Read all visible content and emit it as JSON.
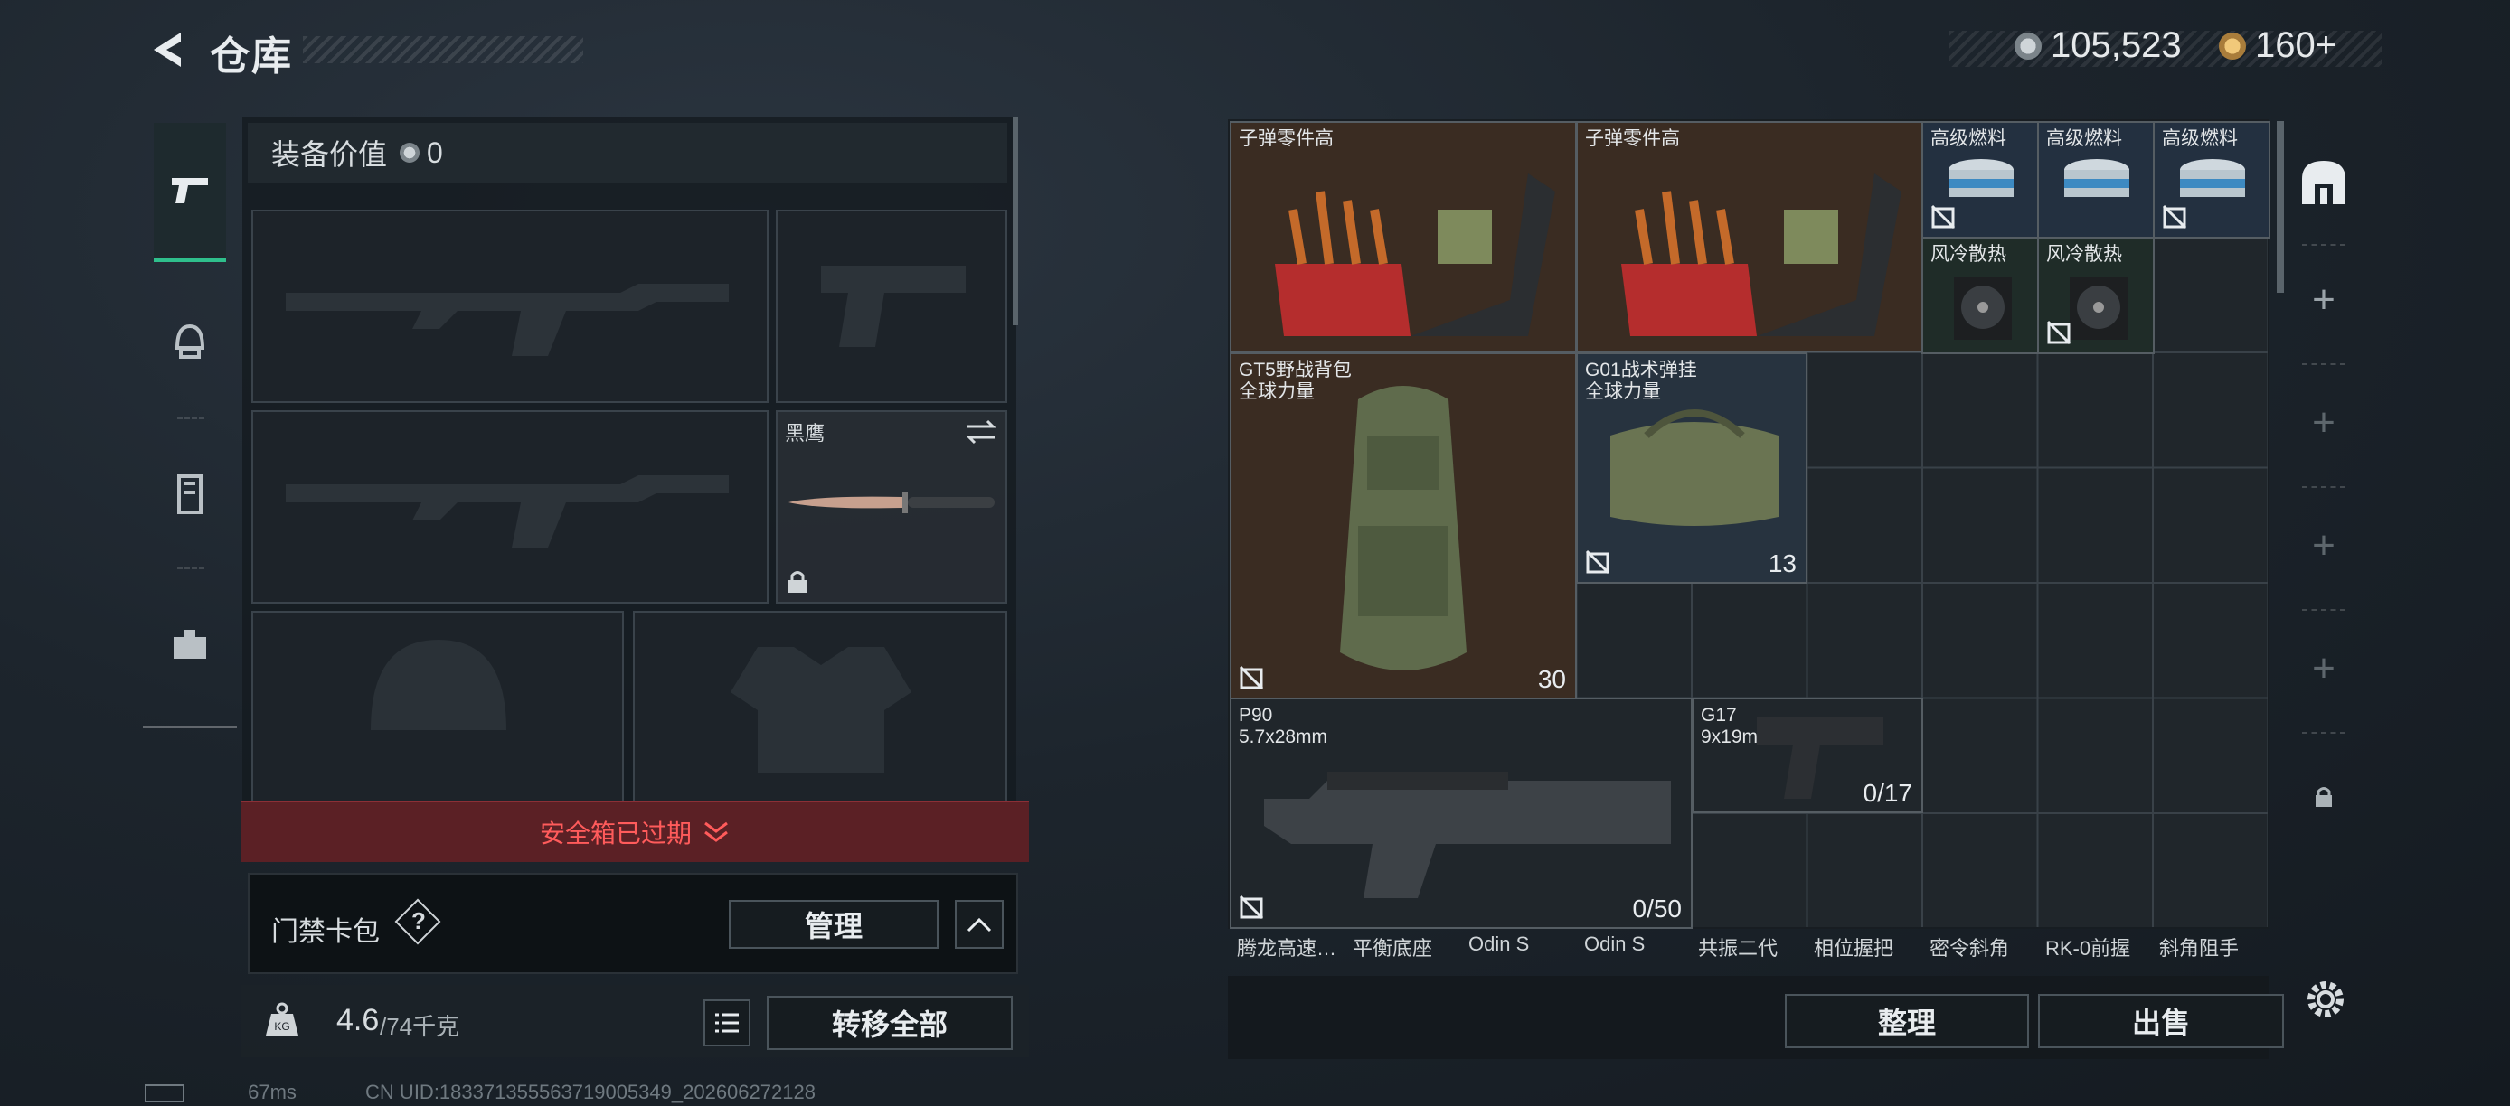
{
  "header": {
    "title": "仓库",
    "currency1": "105,523",
    "currency2": "160+"
  },
  "equip": {
    "value_label": "装备价值",
    "value": "0",
    "knife_name": "黑鹰",
    "safe_box": "安全箱已过期",
    "keycard_label": "门禁卡包",
    "keycard_help": "?",
    "manage_button": "管理",
    "weight": "4.6",
    "weight_max": "/74千克",
    "transfer_all": "转移全部"
  },
  "stash": {
    "items": [
      {
        "name": "子弹零件高"
      },
      {
        "name": "子弹零件高"
      },
      {
        "name": "高级燃料"
      },
      {
        "name": "高级燃料"
      },
      {
        "name": "高级燃料"
      },
      {
        "name": "风冷散热"
      },
      {
        "name": "风冷散热"
      },
      {
        "name": "GT5野战背包\n全球力量",
        "qty": "30"
      },
      {
        "name": "G01战术弹挂\n全球力量",
        "qty": "13"
      },
      {
        "name": "P90\n5.7x28mm",
        "qty": "0/50"
      },
      {
        "name": "G17\n9x19mm",
        "qty": "0/17"
      }
    ],
    "bottom_row": [
      "腾龙高速…",
      "平衡底座",
      "Odin S",
      "Odin S",
      "共振二代",
      "相位握把",
      "密令斜角",
      "RK-0前握",
      "斜角阻手"
    ],
    "sort_button": "整理",
    "sell_button": "出售"
  },
  "status": {
    "ping": "67ms",
    "uid": "CN UID:1833713555637190053​49_202606272128"
  },
  "colors": {
    "accent": "#2fbf8c",
    "warning": "#ff5b5b",
    "bullet_cell": "#3a2c22",
    "fuel_cell": "#233040",
    "cooler_cell": "#1f2c28",
    "vest_cell": "#27333f"
  },
  "icons": [
    "back-icon",
    "pistol-icon",
    "helmet-icon",
    "vest-icon",
    "briefcase-icon",
    "swap-icon",
    "lock-icon",
    "chevron-down-icon",
    "chevron-up-icon",
    "weight-icon",
    "list-icon",
    "base-icon",
    "plus-icon",
    "gear-icon"
  ]
}
